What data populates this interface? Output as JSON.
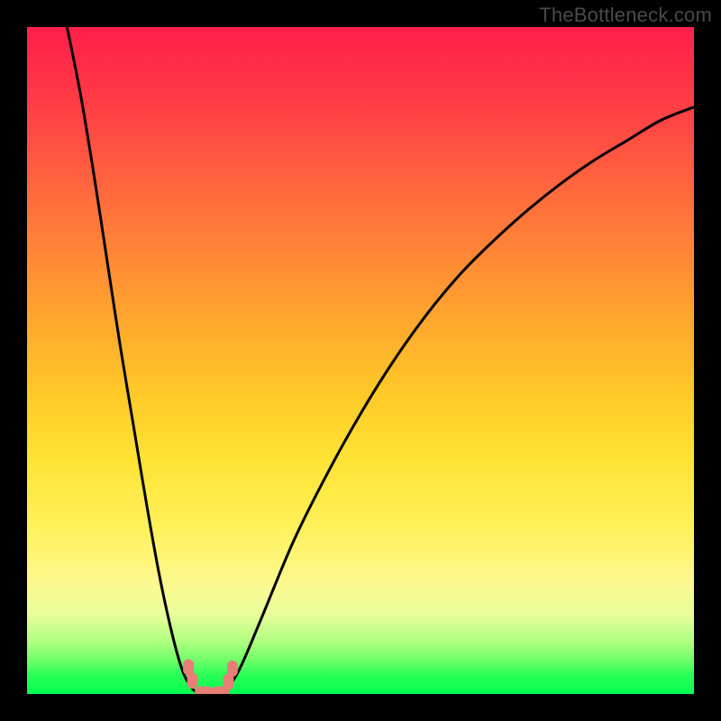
{
  "watermark": "TheBottleneck.com",
  "chart_data": {
    "type": "line",
    "title": "",
    "xlabel": "",
    "ylabel": "",
    "xlim": [
      0,
      100
    ],
    "ylim": [
      0,
      100
    ],
    "grid": false,
    "legend": false,
    "series": [
      {
        "name": "curve-left",
        "x": [
          6,
          8,
          10,
          12,
          14,
          16,
          18,
          20,
          22,
          23.5,
          25
        ],
        "y": [
          100,
          90,
          78,
          65,
          52,
          40,
          28,
          17,
          8,
          3,
          0.5
        ]
      },
      {
        "name": "bottom-flat",
        "x": [
          25,
          26,
          28,
          30
        ],
        "y": [
          0.5,
          0.3,
          0.3,
          0.6
        ]
      },
      {
        "name": "curve-right",
        "x": [
          30,
          32,
          35,
          40,
          45,
          50,
          55,
          60,
          65,
          70,
          75,
          80,
          85,
          90,
          95,
          100
        ],
        "y": [
          0.6,
          4,
          11,
          23,
          33,
          42,
          50,
          57,
          63,
          68,
          72.5,
          76.5,
          80,
          83,
          86,
          88
        ]
      }
    ],
    "markers": [
      {
        "name": "left-marker-upper",
        "x": 24.2,
        "y": 4.0
      },
      {
        "name": "left-marker-lower",
        "x": 24.8,
        "y": 2.0
      },
      {
        "name": "right-marker-upper",
        "x": 30.8,
        "y": 3.8
      },
      {
        "name": "right-marker-lower",
        "x": 30.2,
        "y": 1.8
      },
      {
        "name": "bottom-marker-left",
        "x": 26.5,
        "y": 0.4
      },
      {
        "name": "bottom-marker-right",
        "x": 29.0,
        "y": 0.4
      }
    ],
    "colors": {
      "curve": "#000000",
      "marker": "#e77f77",
      "background_top": "#ff1f4a",
      "background_mid": "#ffe335",
      "background_bottom": "#00ff4f",
      "frame": "#000000"
    }
  }
}
